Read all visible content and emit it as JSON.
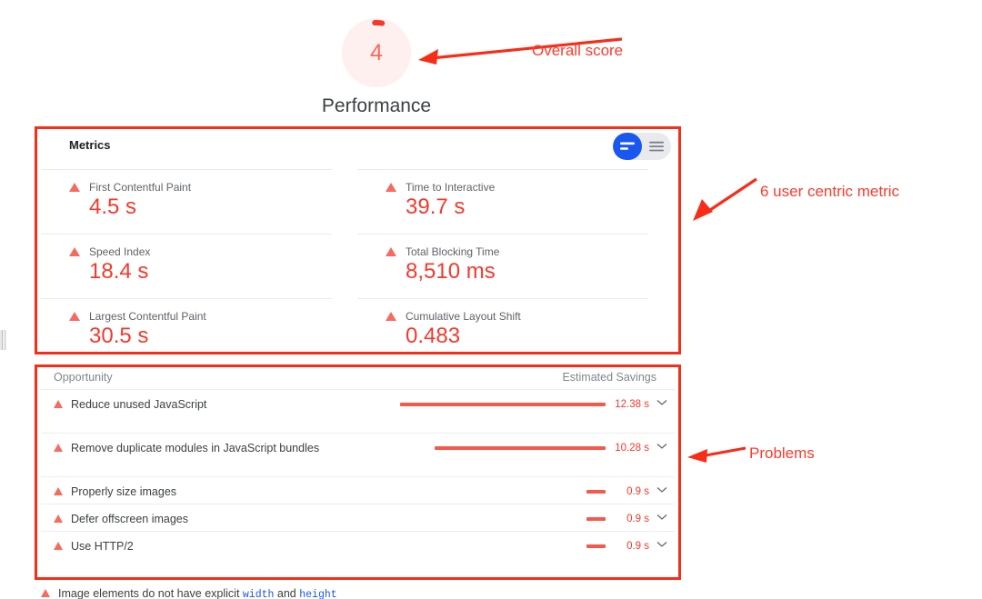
{
  "gauge": {
    "score": "4",
    "category": "Performance",
    "score_color": "#f9675c",
    "track_color": "#fdf0ef",
    "arc_percent": 4
  },
  "annotations": [
    {
      "name": "overall-score",
      "label": "Overall score"
    },
    {
      "name": "six-metrics",
      "label": "6 user centric metric"
    },
    {
      "name": "problems",
      "label": "Problems"
    }
  ],
  "annotation": {
    "overall_score": "Overall score",
    "six_metrics": "6 user centric metric",
    "problems": "Problems",
    "color": "#fc3b2c"
  },
  "metrics_card": {
    "title": "Metrics",
    "toggle": {
      "options": [
        "list-compact-view",
        "list-expanded-view"
      ],
      "active_index": 0,
      "active_color": "#1a56f0",
      "track_color": "#e8eaed"
    },
    "items": [
      {
        "label": "First Contentful Paint",
        "value": "4.5 s",
        "status": "fail"
      },
      {
        "label": "Time to Interactive",
        "value": "39.7 s",
        "status": "fail"
      },
      {
        "label": "Speed Index",
        "value": "18.4 s",
        "status": "fail"
      },
      {
        "label": "Total Blocking Time",
        "value": "8,510 ms",
        "status": "fail"
      },
      {
        "label": "Largest Contentful Paint",
        "value": "30.5 s",
        "status": "fail"
      },
      {
        "label": "Cumulative Layout Shift",
        "value": "0.483",
        "status": "fail"
      }
    ],
    "value_color": "#f4392c",
    "label_color": "#5f6368"
  },
  "opportunities_card": {
    "col_opportunity": "Opportunity",
    "col_savings": "Estimated Savings",
    "rows": [
      {
        "label": "Reduce unused JavaScript",
        "savings": "12.38 s",
        "bar_pct": 96,
        "status": "fail"
      },
      {
        "label": "Remove duplicate modules in JavaScript bundles",
        "savings": "10.28 s",
        "bar_pct": 80,
        "status": "fail"
      },
      {
        "label": "Properly size images",
        "savings": "0.9 s",
        "bar_pct": 9,
        "status": "fail"
      },
      {
        "label": "Defer offscreen images",
        "savings": "0.9 s",
        "bar_pct": 9,
        "status": "fail"
      },
      {
        "label": "Use HTTP/2",
        "savings": "0.9 s",
        "bar_pct": 9,
        "status": "fail"
      }
    ],
    "bar_color": "#f4594c",
    "savings_color": "#f4392c"
  },
  "cutoff_row": {
    "prefix": "Image elements do not have explicit ",
    "code1": "width",
    "middle": " and ",
    "code2": "height"
  }
}
